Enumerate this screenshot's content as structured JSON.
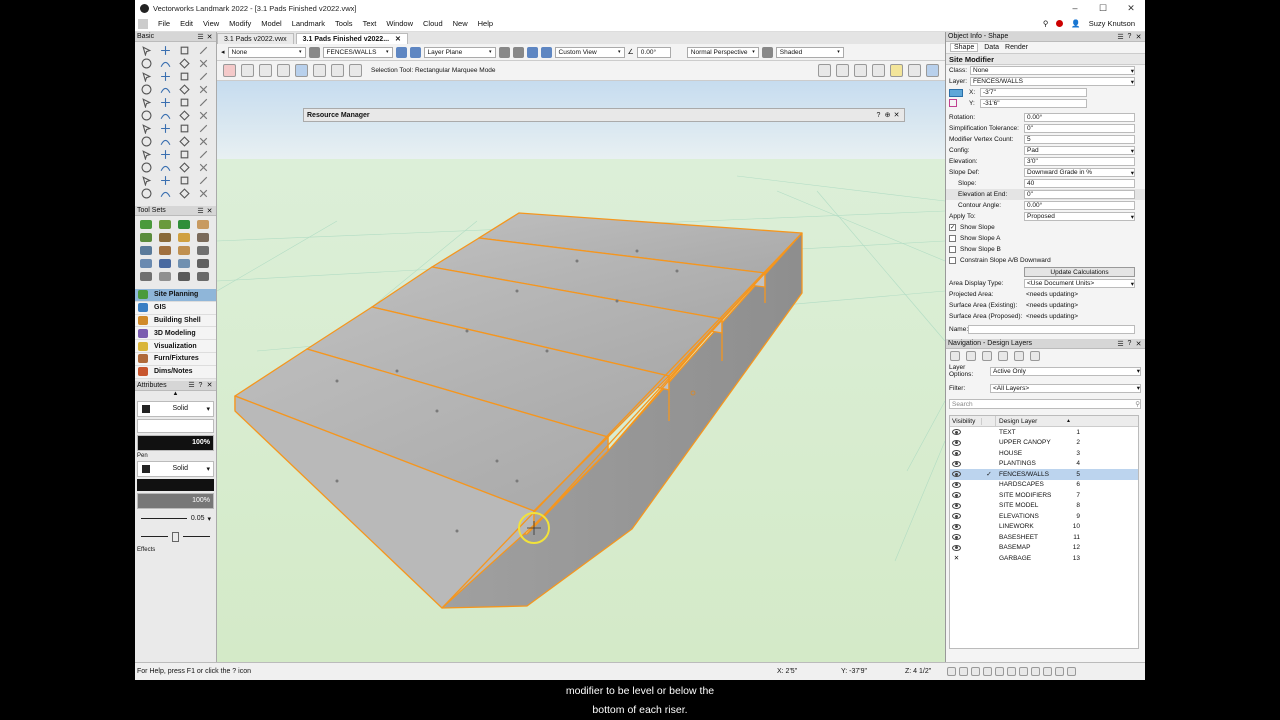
{
  "window": {
    "title": "Vectorworks Landmark 2022 - [3.1 Pads Finished v2022.vwx]",
    "controls": [
      "–",
      "☐",
      "✕"
    ]
  },
  "menu": [
    "File",
    "Edit",
    "View",
    "Modify",
    "Model",
    "Landmark",
    "Tools",
    "Text",
    "Window",
    "Cloud",
    "New",
    "Help"
  ],
  "user": "Suzy Knutson",
  "tabs": [
    {
      "label": "3.1 Pads v2022.vwx",
      "active": false
    },
    {
      "label": "3.1 Pads Finished v2022...",
      "active": true
    }
  ],
  "viewbar": {
    "class": "None",
    "layer": "FENCES/WALLS",
    "plane": "Layer Plane",
    "view": "Custom View",
    "angle": "0.00°",
    "perspective": "Normal Perspective",
    "render": "Shaded"
  },
  "toolbar": {
    "mode_message": "Selection Tool: Rectangular Marquee Mode"
  },
  "palettes": {
    "basic": "Basic",
    "toolsets": "Tool Sets",
    "attributes": "Attributes",
    "pen": "Pen",
    "effects": "Effects",
    "fill_style": "Solid",
    "fill_opacity": "100%",
    "pen_style": "Solid",
    "pen_opacity": "100%",
    "line_weight": "0.05"
  },
  "workspaces": [
    {
      "label": "Site Planning",
      "color": "#4a9a3c",
      "active": true
    },
    {
      "label": "GIS",
      "color": "#3a7fc4",
      "active": false
    },
    {
      "label": "Building Shell",
      "color": "#d08a2a",
      "active": false
    },
    {
      "label": "3D Modeling",
      "color": "#7a5cb0",
      "active": false
    },
    {
      "label": "Visualization",
      "color": "#d9b53a",
      "active": false
    },
    {
      "label": "Furn/Fixtures",
      "color": "#b06a3a",
      "active": false
    },
    {
      "label": "Dims/Notes",
      "color": "#c8562e",
      "active": false
    }
  ],
  "resource_manager": {
    "title": "Resource Manager",
    "buttons": [
      "?",
      "⊕",
      "✕"
    ]
  },
  "object_info": {
    "title": "Object Info - Shape",
    "tabs": [
      "Shape",
      "Data",
      "Render"
    ],
    "object_type": "Site Modifier",
    "class": "None",
    "layer": "FENCES/WALLS",
    "x": "-3'7\"",
    "y": "-31'6\"",
    "props": [
      {
        "label": "Rotation:",
        "value": "0.00°",
        "indent": false,
        "dropdown": false
      },
      {
        "label": "Simplification Tolerance:",
        "value": "0\"",
        "indent": false,
        "dropdown": false
      },
      {
        "label": "Modifier Vertex Count:",
        "value": "5",
        "indent": false,
        "dropdown": false
      },
      {
        "label": "Config:",
        "value": "Pad",
        "indent": false,
        "dropdown": true
      },
      {
        "label": "Elevation:",
        "value": "3'0\"",
        "indent": false,
        "dropdown": false
      },
      {
        "label": "Slope Def:",
        "value": "Downward Grade in %",
        "indent": false,
        "dropdown": true
      },
      {
        "label": "Slope:",
        "value": "40",
        "indent": true,
        "dropdown": false
      },
      {
        "label": "Elevation at End:",
        "value": "0\"",
        "indent": true,
        "dropdown": false
      },
      {
        "label": "Contour Angle:",
        "value": "0.00°",
        "indent": true,
        "dropdown": false
      },
      {
        "label": "Apply To:",
        "value": "Proposed",
        "indent": false,
        "dropdown": true
      }
    ],
    "checkboxes": [
      {
        "label": "Show Slope",
        "checked": true
      },
      {
        "label": "Show Slope A",
        "checked": false
      },
      {
        "label": "Show Slope B",
        "checked": false
      },
      {
        "label": "Constrain Slope A/B Downward",
        "checked": false
      }
    ],
    "update_button": "Update Calculations",
    "props2": [
      {
        "label": "Area Display Type:",
        "value": "<Use Document Units>",
        "dropdown": true
      },
      {
        "label": "Projected Area:",
        "value": "<needs updating>",
        "dropdown": false
      },
      {
        "label": "Surface Area (Existing):",
        "value": "<needs updating>",
        "dropdown": false
      },
      {
        "label": "Surface Area (Proposed):",
        "value": "<needs updating>",
        "dropdown": false
      }
    ],
    "name_label": "Name:"
  },
  "navigation": {
    "title": "Navigation - Design Layers",
    "layer_options_label": "Layer Options:",
    "layer_options_value": "Active Only",
    "filter_label": "Filter:",
    "filter_value": "<All Layers>",
    "search_placeholder": "Search",
    "col_visibility": "Visibility",
    "col_layer": "Design Layer",
    "layers": [
      {
        "name": "TEXT",
        "num": "1",
        "visible": true,
        "active": false
      },
      {
        "name": "UPPER CANOPY",
        "num": "2",
        "visible": true,
        "active": false
      },
      {
        "name": "HOUSE",
        "num": "3",
        "visible": true,
        "active": false
      },
      {
        "name": "PLANTINGS",
        "num": "4",
        "visible": true,
        "active": false
      },
      {
        "name": "FENCES/WALLS",
        "num": "5",
        "visible": true,
        "active": true
      },
      {
        "name": "HARDSCAPES",
        "num": "6",
        "visible": true,
        "active": false
      },
      {
        "name": "SITE MODIFIERS",
        "num": "7",
        "visible": true,
        "active": false
      },
      {
        "name": "SITE MODEL",
        "num": "8",
        "visible": true,
        "active": false
      },
      {
        "name": "ELEVATIONS",
        "num": "9",
        "visible": true,
        "active": false
      },
      {
        "name": "LINEWORK",
        "num": "10",
        "visible": true,
        "active": false
      },
      {
        "name": "BASESHEET",
        "num": "11",
        "visible": true,
        "active": false
      },
      {
        "name": "BASEMAP",
        "num": "12",
        "visible": true,
        "active": false
      },
      {
        "name": "GARBAGE",
        "num": "13",
        "visible": false,
        "active": false
      }
    ]
  },
  "status": {
    "help": "For Help, press F1 or click the ? icon",
    "x": "X: 2'5\"",
    "y": "Y: -37'9\"",
    "z": "Z: 4 1/2\""
  },
  "caption": {
    "line1": "modifier to be level or below the",
    "line2": "bottom of each riser."
  },
  "colors": {
    "accent": "#f5961e",
    "selection": "#bcd4ee",
    "sky_top": "#c9dff2",
    "ground": "#d8ecd0"
  }
}
